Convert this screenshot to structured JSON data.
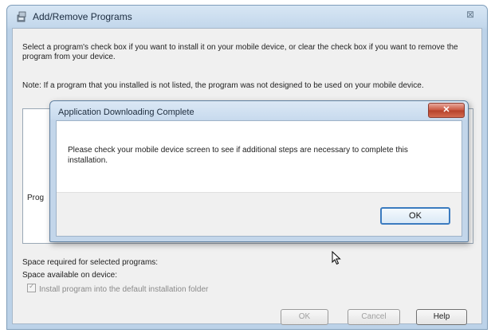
{
  "outer_window": {
    "title": "Add/Remove Programs",
    "close_glyph": "⊠",
    "intro_text": "Select a program's check box if you want to install it on your mobile device, or clear the check box if you want to remove the program from your device.",
    "note_text": "Note: If a program that you installed is not listed, the program was not designed to be used on your mobile device.",
    "programs_label": "Prog",
    "space_required_label": "Space required for selected programs:",
    "space_available_label": "Space available on device:",
    "install_checkbox_label": "Install program into the default installation folder",
    "buttons": {
      "ok": "OK",
      "cancel": "Cancel",
      "help": "Help"
    }
  },
  "dialog": {
    "title": "Application Downloading Complete",
    "close_glyph": "✕",
    "message": "Please check your mobile device screen to see if additional steps are necessary to complete this installation.",
    "ok_label": "OK"
  },
  "icons": {
    "app": "add-remove-programs-icon",
    "cursor": "mouse-pointer-icon"
  }
}
